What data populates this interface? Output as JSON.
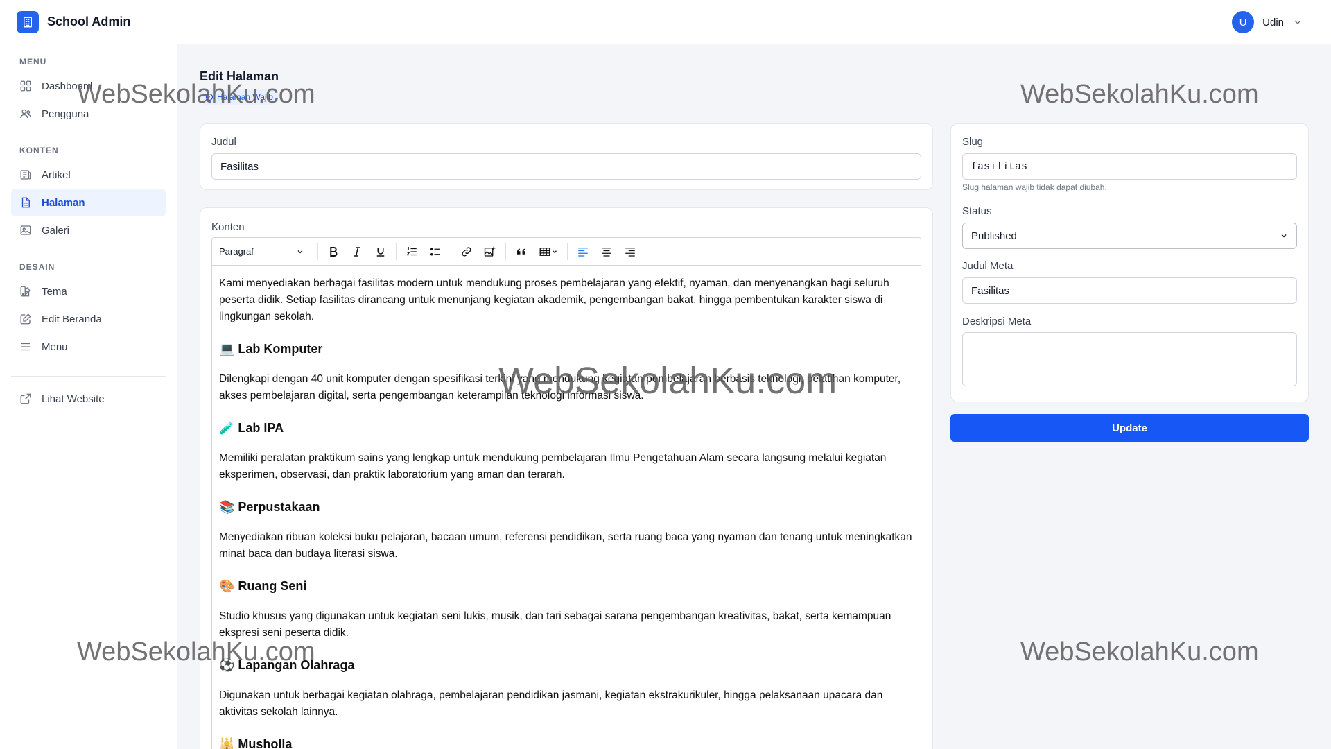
{
  "brand": {
    "name": "School Admin"
  },
  "user": {
    "initial": "U",
    "name": "Udin"
  },
  "sidebar": {
    "sections": [
      {
        "heading": "MENU",
        "items": [
          {
            "label": "Dashboard"
          },
          {
            "label": "Pengguna"
          }
        ]
      },
      {
        "heading": "KONTEN",
        "items": [
          {
            "label": "Artikel"
          },
          {
            "label": "Halaman"
          },
          {
            "label": "Galeri"
          }
        ]
      },
      {
        "heading": "DESAIN",
        "items": [
          {
            "label": "Tema"
          },
          {
            "label": "Edit Beranda"
          },
          {
            "label": "Menu"
          }
        ]
      }
    ],
    "external": {
      "label": "Lihat Website"
    },
    "active_item": "Halaman"
  },
  "page": {
    "title": "Edit Halaman",
    "badge": "Halaman Wajib"
  },
  "form": {
    "judul": {
      "label": "Judul",
      "value": "Fasilitas"
    },
    "konten": {
      "label": "Konten"
    },
    "slug": {
      "label": "Slug",
      "value": "fasilitas",
      "hint": "Slug halaman wajib tidak dapat diubah."
    },
    "status": {
      "label": "Status",
      "value": "Published"
    },
    "judul_meta": {
      "label": "Judul Meta",
      "value": "Fasilitas"
    },
    "deskripsi_meta": {
      "label": "Deskripsi Meta",
      "value": ""
    },
    "submit": "Update"
  },
  "editor": {
    "block_format": "Paragraf",
    "content": {
      "intro": "Kami menyediakan berbagai fasilitas modern untuk mendukung proses pembelajaran yang efektif, nyaman, dan menyenangkan bagi seluruh peserta didik. Setiap fasilitas dirancang untuk menunjang kegiatan akademik, pengembangan bakat, hingga pembentukan karakter siswa di lingkungan sekolah.",
      "sections": [
        {
          "heading": "💻 Lab Komputer",
          "body": "Dilengkapi dengan 40 unit komputer dengan spesifikasi terkini yang mendukung kegiatan pembelajaran berbasis teknologi, pelatihan komputer, akses pembelajaran digital, serta pengembangan keterampilan teknologi informasi siswa."
        },
        {
          "heading": "🧪 Lab IPA",
          "body": "Memiliki peralatan praktikum sains yang lengkap untuk mendukung pembelajaran Ilmu Pengetahuan Alam secara langsung melalui kegiatan eksperimen, observasi, dan praktik laboratorium yang aman dan terarah."
        },
        {
          "heading": "📚 Perpustakaan",
          "body": "Menyediakan ribuan koleksi buku pelajaran, bacaan umum, referensi pendidikan, serta ruang baca yang nyaman dan tenang untuk meningkatkan minat baca dan budaya literasi siswa."
        },
        {
          "heading": "🎨 Ruang Seni",
          "body": "Studio khusus yang digunakan untuk kegiatan seni lukis, musik, dan tari sebagai sarana pengembangan kreativitas, bakat, serta kemampuan ekspresi seni peserta didik."
        },
        {
          "heading": "⚽ Lapangan Olahraga",
          "body": "Digunakan untuk berbagai kegiatan olahraga, pembelajaran pendidikan jasmani, kegiatan ekstrakurikuler, hingga pelaksanaan upacara dan aktivitas sekolah lainnya."
        },
        {
          "heading": "🕌 Musholla",
          "body": ""
        }
      ]
    }
  },
  "watermark": "WebSekolahKu.com",
  "colors": {
    "primary": "#1757f5",
    "active_bg": "#eef4ff",
    "active_text": "#1d4ed8"
  }
}
